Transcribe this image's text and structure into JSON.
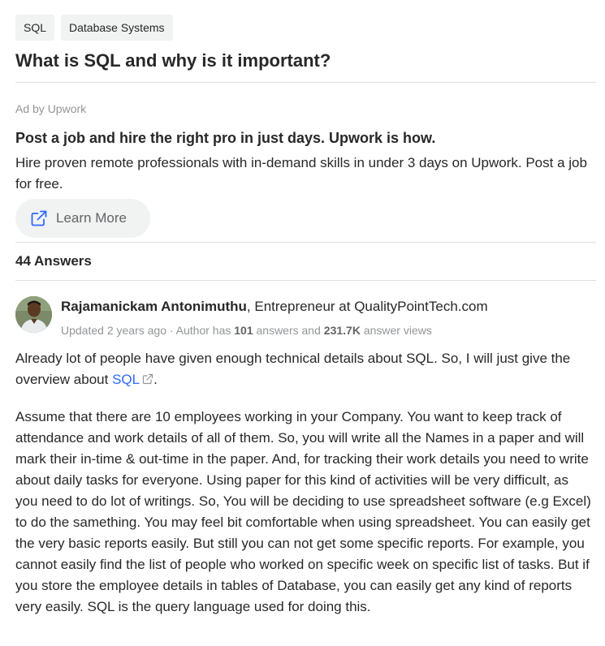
{
  "tags": [
    "SQL",
    "Database Systems"
  ],
  "question": {
    "title": "What is SQL and why is it important?"
  },
  "ad": {
    "label": "Ad by Upwork",
    "headline": "Post a job and hire the right pro in just days. Upwork is how.",
    "body": "Hire proven remote professionals with in-demand skills in under 3 days on Upwork. Post a job for free.",
    "button_label": "Learn More",
    "button_icon": "external-link-icon"
  },
  "answers_count": "44 Answers",
  "answer": {
    "author": {
      "name": "Rajamanickam Antonimuthu",
      "credential": ", Entrepreneur at QualityPointTech.com"
    },
    "meta": {
      "prefix": "Updated 2 years ago · Author has ",
      "answers_num": "101",
      "mid": " answers and ",
      "views_num": "231.7K",
      "suffix": " answer views"
    },
    "para1_before": "Already lot of people have given enough technical details about SQL. So, I will just give the overview about ",
    "para1_link": "SQL",
    "para1_after": ".",
    "para2": "Assume that there are 10 employees working in your Company. You want to keep track of attendance and work details of all of them. So, you will write all the Names in a paper and will mark their in-time & out-time in the paper. And, for tracking their work details you need to write about daily tasks for everyone. Using paper for this kind of activities will be very difficult, as you need to do lot of writings. So, You will be deciding to use spreadsheet software (e.g Excel) to do the samething. You may feel bit comfortable when using spreadsheet. You can easily get the very basic reports easily. But still you can not get some specific reports. For example, you cannot easily find the list of people who worked on specific week on specific list of tasks. But if you store the employee details in tables of Database, you can easily get any kind of reports very easily. SQL is the query language used for doing this."
  },
  "colors": {
    "text": "#282829",
    "muted": "#939598",
    "link": "#2e69ff",
    "tag_bg": "#f1f2f2",
    "divider": "#dedfe0"
  }
}
